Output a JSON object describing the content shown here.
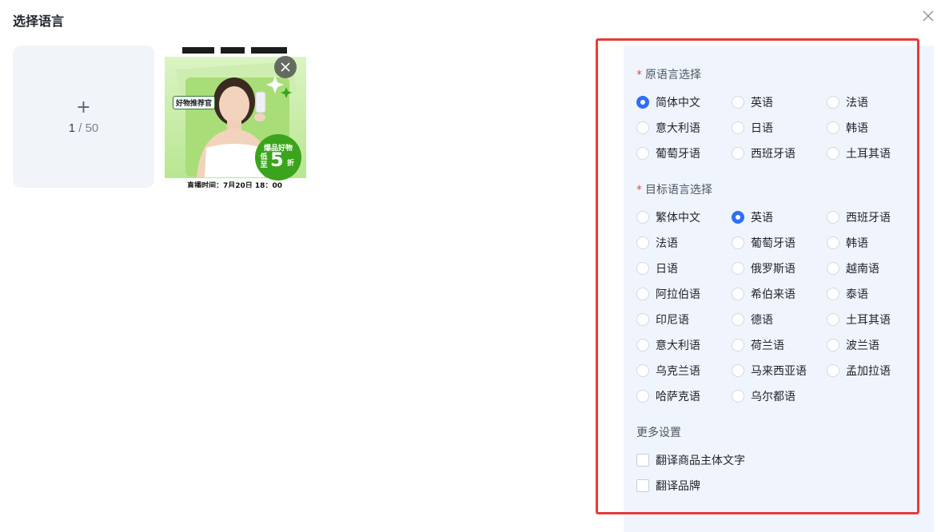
{
  "dialog": {
    "title": "选择语言"
  },
  "upload": {
    "plus": "+",
    "current": "1",
    "separator": " / ",
    "max": "50"
  },
  "thumbnail": {
    "tag": "好物推荐官",
    "badge_top": "爆品好物",
    "badge_left": "低至",
    "badge_number": "5",
    "badge_unit": "折",
    "footer": "直播时间：7月20日 18：00"
  },
  "source_language": {
    "label": "原语言选择",
    "required_mark": "*",
    "selected": "简体中文",
    "options": [
      "简体中文",
      "英语",
      "法语",
      "意大利语",
      "日语",
      "韩语",
      "葡萄牙语",
      "西班牙语",
      "土耳其语"
    ]
  },
  "target_language": {
    "label": "目标语言选择",
    "required_mark": "*",
    "selected": "英语",
    "options": [
      "繁体中文",
      "英语",
      "西班牙语",
      "法语",
      "葡萄牙语",
      "韩语",
      "日语",
      "俄罗斯语",
      "越南语",
      "阿拉伯语",
      "希伯来语",
      "泰语",
      "印尼语",
      "德语",
      "土耳其语",
      "意大利语",
      "荷兰语",
      "波兰语",
      "乌克兰语",
      "马来西亚语",
      "孟加拉语",
      "哈萨克语",
      "乌尔都语"
    ]
  },
  "more_settings": {
    "label": "更多设置",
    "options": [
      "翻译商品主体文字",
      "翻译品牌"
    ]
  },
  "colors": {
    "accent": "#2e6ff5",
    "highlight_border": "#e63b3b",
    "panel_bg": "#f0f5fd"
  }
}
